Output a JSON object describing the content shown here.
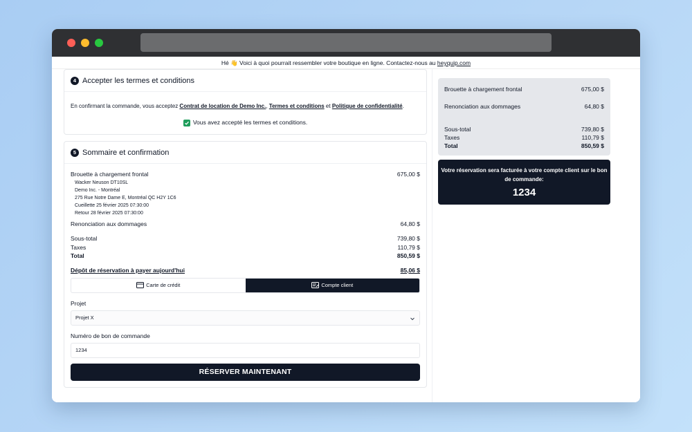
{
  "banner": {
    "text": "Hé 👋 Voici à quoi pourrait ressembler votre boutique en ligne. Contactez-nous au",
    "link": "heyquip.com"
  },
  "terms": {
    "step": "4",
    "title": "Accepter les termes et conditions",
    "intro": "En confirmant la commande, vous acceptez",
    "link1": "Contrat de location de Demo Inc.",
    "sep1": ",",
    "link2": "Termes et conditions",
    "and": "et",
    "link3": "Politique de confidentialité",
    "end": ".",
    "accepted": "Vous avez accepté les termes et conditions."
  },
  "summary": {
    "step": "5",
    "title": "Sommaire et confirmation",
    "item_name": "Brouette à chargement frontal",
    "item_price": "675,00 $",
    "details": [
      "Wacker Neuson DT10SL",
      "Demo Inc. - Montréal",
      "275 Rue Notre Dame E, Montréal QC H2Y 1C6",
      "Cueillette 25 février 2025 07:30:00",
      "Retour 28 février 2025 07:30:00"
    ],
    "waiver_label": "Renonciation aux dommages",
    "waiver_price": "64,80 $",
    "subtotal_label": "Sous-total",
    "subtotal": "739,80 $",
    "taxes_label": "Taxes",
    "taxes": "110,79 $",
    "total_label": "Total",
    "total": "850,59 $",
    "deposit_label": "Dépôt de réservation à payer aujourd'hui",
    "deposit": "85,06 $",
    "tab_credit": "Carte de crédit",
    "tab_account": "Compte client",
    "project_label": "Projet",
    "project_value": "Projet X",
    "po_label": "Numéro de bon de commande",
    "po_value": "1234",
    "reserve_button": "RÉSERVER MAINTENANT"
  },
  "side": {
    "item_name": "Brouette à chargement frontal",
    "item_price": "675,00 $",
    "waiver_label": "Renonciation aux dommages",
    "waiver_price": "64,80 $",
    "subtotal_label": "Sous-total",
    "subtotal": "739,80 $",
    "taxes_label": "Taxes",
    "taxes": "110,79 $",
    "total_label": "Total",
    "total": "850,59 $",
    "notice": "Votre réservation sera facturée à votre compte client sur le bon de commande:",
    "po_number": "1234"
  },
  "colors": {
    "dark": "#111827",
    "check_green": "#1f9d5b",
    "summary_bg": "#e5e7eb"
  }
}
